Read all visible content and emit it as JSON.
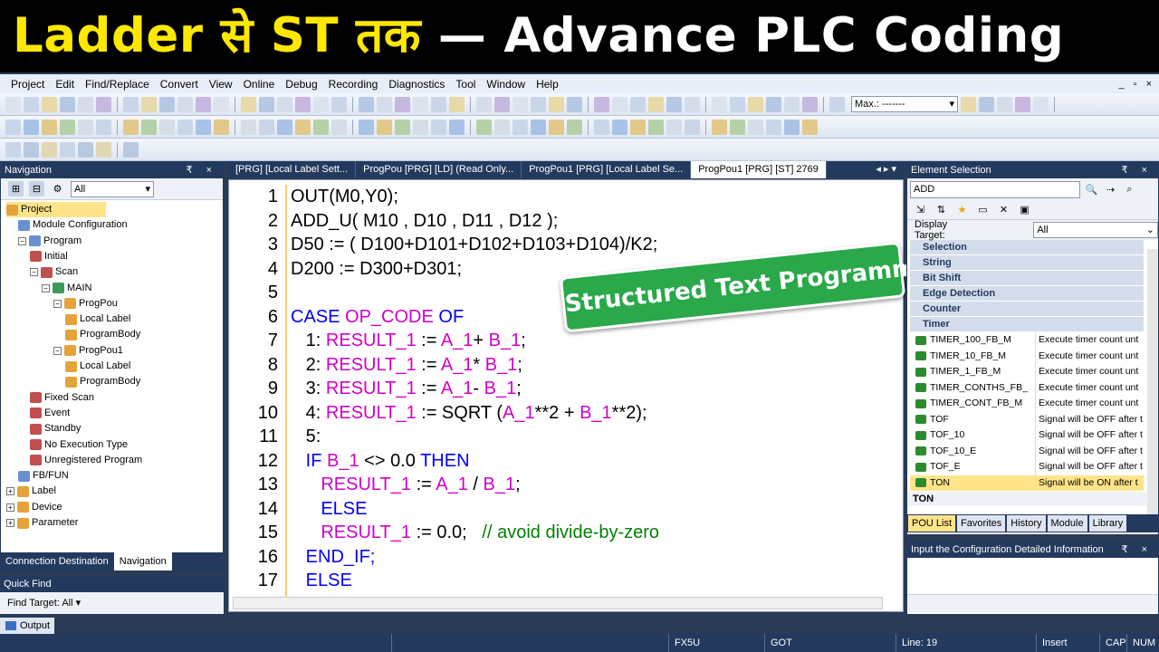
{
  "banner": {
    "part1": "Ladder से ST तक",
    "part2": "— Advance PLC Coding"
  },
  "menu": {
    "items": [
      "Project",
      "Edit",
      "Find/Replace",
      "Convert",
      "View",
      "Online",
      "Debug",
      "Recording",
      "Diagnostics",
      "Tool",
      "Window",
      "Help"
    ],
    "win_controls": [
      "_",
      "▫",
      "×"
    ]
  },
  "toolbar": {
    "zoom_value": "Max.: -------",
    "nav_filter": "All"
  },
  "navigation": {
    "title": "Navigation",
    "pin": "₹ ×",
    "filter": "All",
    "tree": [
      {
        "label": "Project",
        "level": 0,
        "selected": true
      },
      {
        "label": "Module Configuration",
        "level": 1
      },
      {
        "label": "Program",
        "level": 1,
        "exp": "−"
      },
      {
        "label": "Initial",
        "level": 2
      },
      {
        "label": "Scan",
        "level": 2,
        "exp": "−"
      },
      {
        "label": "MAIN",
        "level": 3,
        "exp": "−"
      },
      {
        "label": "ProgPou",
        "level": 4,
        "exp": "−"
      },
      {
        "label": "Local Label",
        "level": 5
      },
      {
        "label": "ProgramBody",
        "level": 5
      },
      {
        "label": "ProgPou1",
        "level": 4,
        "exp": "−"
      },
      {
        "label": "Local Label",
        "level": 5
      },
      {
        "label": "ProgramBody",
        "level": 5
      },
      {
        "label": "Fixed Scan",
        "level": 2
      },
      {
        "label": "Event",
        "level": 2
      },
      {
        "label": "Standby",
        "level": 2
      },
      {
        "label": "No Execution Type",
        "level": 2
      },
      {
        "label": "Unregistered Program",
        "level": 2
      },
      {
        "label": "FB/FUN",
        "level": 1
      },
      {
        "label": "Label",
        "level": 0,
        "exp": "+"
      },
      {
        "label": "Device",
        "level": 0,
        "exp": "+"
      },
      {
        "label": "Parameter",
        "level": 0,
        "exp": "+"
      }
    ],
    "tabs": [
      "Connection Destination",
      "Navigation"
    ]
  },
  "quick_find": {
    "title": "Quick Find",
    "target": "Find Target: All ▾"
  },
  "editor": {
    "tabs": [
      "[PRG] [Local Label Sett...",
      "ProgPou [PRG] [LD] (Read Only...",
      "ProgPou1 [PRG] [Local Label Se...",
      "ProgPou1 [PRG] [ST] 2769"
    ],
    "tab_nav": "◂ ▸ ▾",
    "lines": [
      {
        "n": "1",
        "parts": [
          {
            "t": "OUT(M0,Y0);",
            "c": "p"
          }
        ]
      },
      {
        "n": "2",
        "parts": [
          {
            "t": "ADD_U( M10 , D10 , D11 , D12 );",
            "c": "p"
          }
        ]
      },
      {
        "n": "3",
        "parts": [
          {
            "t": "D50 := ( D100+D101+D102+D103+D104)/K2;",
            "c": "p"
          }
        ]
      },
      {
        "n": "4",
        "parts": [
          {
            "t": "D200 := D300+D301;",
            "c": "p"
          }
        ]
      },
      {
        "n": "5",
        "parts": []
      },
      {
        "n": "6",
        "parts": [
          {
            "t": "CASE ",
            "c": "kw"
          },
          {
            "t": "OP_CODE",
            "c": "var"
          },
          {
            "t": " OF",
            "c": "kw"
          }
        ]
      },
      {
        "n": "7",
        "parts": [
          {
            "t": "   1: ",
            "c": "p"
          },
          {
            "t": "RESULT_1",
            "c": "var"
          },
          {
            "t": " := ",
            "c": "p"
          },
          {
            "t": "A_1",
            "c": "var"
          },
          {
            "t": "+ ",
            "c": "p"
          },
          {
            "t": "B_1",
            "c": "var"
          },
          {
            "t": ";",
            "c": "p"
          }
        ]
      },
      {
        "n": "8",
        "parts": [
          {
            "t": "   2: ",
            "c": "p"
          },
          {
            "t": "RESULT_1",
            "c": "var"
          },
          {
            "t": " := ",
            "c": "p"
          },
          {
            "t": "A_1",
            "c": "var"
          },
          {
            "t": "* ",
            "c": "p"
          },
          {
            "t": "B_1",
            "c": "var"
          },
          {
            "t": ";",
            "c": "p"
          }
        ]
      },
      {
        "n": "9",
        "parts": [
          {
            "t": "   3: ",
            "c": "p"
          },
          {
            "t": "RESULT_1",
            "c": "var"
          },
          {
            "t": " := ",
            "c": "p"
          },
          {
            "t": "A_1",
            "c": "var"
          },
          {
            "t": "- ",
            "c": "p"
          },
          {
            "t": "B_1",
            "c": "var"
          },
          {
            "t": ";",
            "c": "p"
          }
        ]
      },
      {
        "n": "10",
        "parts": [
          {
            "t": "   4: ",
            "c": "p"
          },
          {
            "t": "RESULT_1",
            "c": "var"
          },
          {
            "t": " := SQRT (",
            "c": "p"
          },
          {
            "t": "A_1",
            "c": "var"
          },
          {
            "t": "**2 + ",
            "c": "p"
          },
          {
            "t": "B_1",
            "c": "var"
          },
          {
            "t": "**2);",
            "c": "p"
          }
        ]
      },
      {
        "n": "11",
        "parts": [
          {
            "t": "   5:",
            "c": "p"
          }
        ]
      },
      {
        "n": "12",
        "parts": [
          {
            "t": "   IF ",
            "c": "kw"
          },
          {
            "t": "B_1",
            "c": "var"
          },
          {
            "t": " <> 0.0 ",
            "c": "p"
          },
          {
            "t": "THEN",
            "c": "kw"
          }
        ]
      },
      {
        "n": "13",
        "parts": [
          {
            "t": "      ",
            "c": "p"
          },
          {
            "t": "RESULT_1",
            "c": "var"
          },
          {
            "t": " := ",
            "c": "p"
          },
          {
            "t": "A_1",
            "c": "var"
          },
          {
            "t": " / ",
            "c": "p"
          },
          {
            "t": "B_1",
            "c": "var"
          },
          {
            "t": ";",
            "c": "p"
          }
        ]
      },
      {
        "n": "14",
        "parts": [
          {
            "t": "      ELSE",
            "c": "kw"
          }
        ]
      },
      {
        "n": "15",
        "parts": [
          {
            "t": "      ",
            "c": "p"
          },
          {
            "t": "RESULT_1",
            "c": "var"
          },
          {
            "t": " := 0.0;   ",
            "c": "p"
          },
          {
            "t": "// avoid divide-by-zero",
            "c": "cmt"
          }
        ]
      },
      {
        "n": "16",
        "parts": [
          {
            "t": "   END_IF;",
            "c": "kw"
          }
        ]
      },
      {
        "n": "17",
        "parts": [
          {
            "t": "   ELSE",
            "c": "kw"
          }
        ]
      }
    ]
  },
  "callout": "Structured Text Programming",
  "element_selection": {
    "title": "Element Selection",
    "search": "ADD",
    "display_target_label": "Display Target:",
    "display_target_value": "All",
    "categories": [
      "Selection",
      "String",
      "Bit Shift",
      "Edge Detection",
      "Counter",
      "Timer"
    ],
    "rows": [
      {
        "name": "TIMER_100_FB_M",
        "desc": "Execute timer count unt"
      },
      {
        "name": "TIMER_10_FB_M",
        "desc": "Execute timer count unt"
      },
      {
        "name": "TIMER_1_FB_M",
        "desc": "Execute timer count unt"
      },
      {
        "name": "TIMER_CONTHS_FB_",
        "desc": "Execute timer count unt"
      },
      {
        "name": "TIMER_CONT_FB_M",
        "desc": "Execute timer count unt"
      },
      {
        "name": "TOF",
        "desc": "Signal will be OFF after t"
      },
      {
        "name": "TOF_10",
        "desc": "Signal will be OFF after t"
      },
      {
        "name": "TOF_10_E",
        "desc": "Signal will be OFF after t"
      },
      {
        "name": "TOF_E",
        "desc": "Signal will be OFF after t"
      },
      {
        "name": "TON",
        "desc": "Signal will be ON after t",
        "selected": true
      }
    ],
    "selected_name": "TON",
    "tabs": [
      "POU List",
      "Favorites",
      "History",
      "Module",
      "Library"
    ]
  },
  "config_info": {
    "title": "Input the Configuration Detailed Information"
  },
  "output": {
    "label": "Output"
  },
  "status": {
    "plc": "FX5U",
    "target": "GOT",
    "line": "Line: 19",
    "mode": "Insert",
    "cap": "CAP",
    "num": "NUM"
  }
}
